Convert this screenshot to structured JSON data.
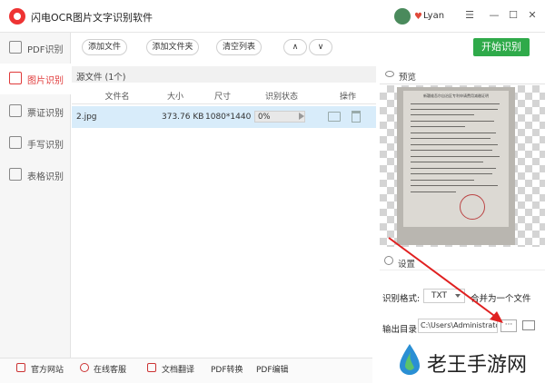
{
  "app": {
    "title": "闪电OCR图片文字识别软件",
    "username": "Lyan",
    "window_controls": [
      "☰",
      "—",
      "☐",
      "✕"
    ]
  },
  "sidebar": {
    "items": [
      {
        "label": "PDF识别",
        "active": false
      },
      {
        "label": "图片识别",
        "active": true
      },
      {
        "label": "票证识别",
        "active": false
      },
      {
        "label": "手写识别",
        "active": false
      },
      {
        "label": "表格识别",
        "active": false
      }
    ],
    "submenu_arrow": "›"
  },
  "toolbar": {
    "add_file": "添加文件",
    "add_folder": "添加文件夹",
    "clear_list": "清空列表",
    "up": "∧",
    "down": "∨",
    "start": "开始识别"
  },
  "file_list": {
    "source_label": "源文件 (1个)",
    "columns": [
      "文件名",
      "大小",
      "尺寸",
      "识别状态",
      "操作"
    ],
    "rows": [
      {
        "name": "2.jpg",
        "size": "373.76 KB",
        "dimensions": "1080*1440",
        "progress": "0%"
      }
    ]
  },
  "preview": {
    "label": "预览",
    "doc_heading": "新疆维吾尔自治区专利申请费用减缴证明"
  },
  "settings": {
    "label": "设置",
    "format_label": "识别格式:",
    "format_value": "TXT",
    "merge_label": "合并为一个文件",
    "output_label": "输出目录",
    "output_path": "C:\\Users\\Administrator\\",
    "browse": "···"
  },
  "bottom_bar": {
    "items": [
      "官方网站",
      "在线客服",
      "文档翻译",
      "PDF转换",
      "PDF编辑"
    ]
  },
  "watermark": {
    "text": "老王手游网"
  },
  "colors": {
    "accent_red": "#e03a3a",
    "start_green": "#2faa4a",
    "row_selected": "#d8ecfa"
  }
}
